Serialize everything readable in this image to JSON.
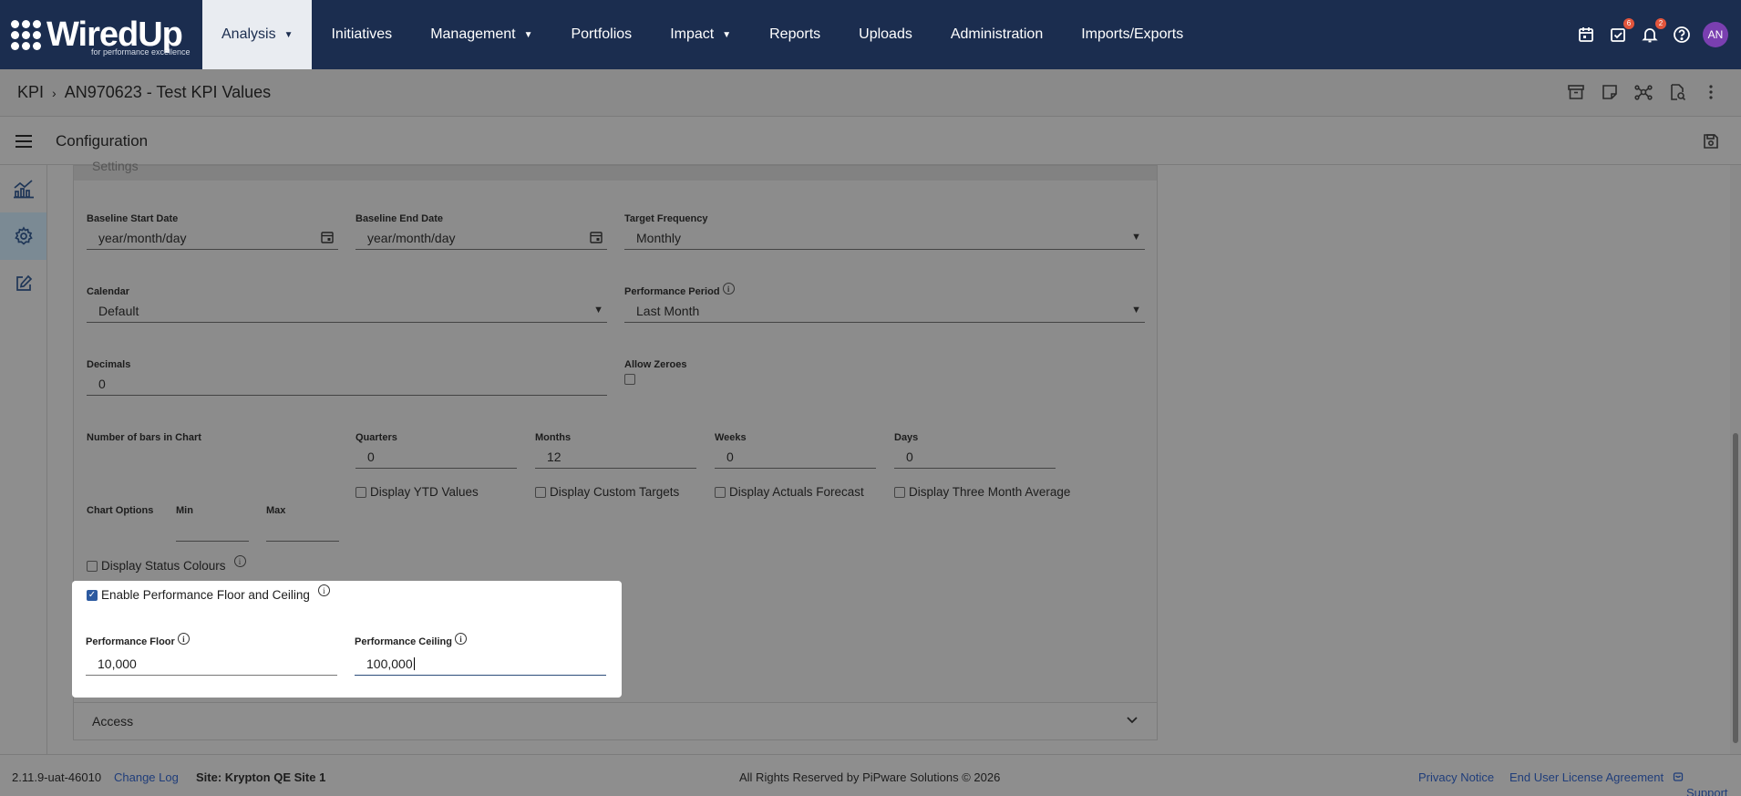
{
  "nav": {
    "logo_text": "WiredUp",
    "logo_sub": "for performance excellence",
    "items": [
      {
        "label": "Analysis",
        "caret": "▼"
      },
      {
        "label": "Initiatives",
        "caret": ""
      },
      {
        "label": "Management",
        "caret": "▼"
      },
      {
        "label": "Portfolios",
        "caret": ""
      },
      {
        "label": "Impact",
        "caret": "▼"
      },
      {
        "label": "Reports",
        "caret": ""
      },
      {
        "label": "Uploads",
        "caret": ""
      },
      {
        "label": "Administration",
        "caret": ""
      },
      {
        "label": "Imports/Exports",
        "caret": ""
      }
    ],
    "tasks_badge": "6",
    "notifications_badge": "2",
    "avatar": "AN"
  },
  "breadcrumb": {
    "root": "KPI",
    "sep": "›",
    "current": "AN970623 - Test KPI Values"
  },
  "config": {
    "title": "Configuration"
  },
  "settings": {
    "header": "Settings",
    "baseline_start": {
      "label": "Baseline Start Date",
      "value": "year/month/day"
    },
    "baseline_end": {
      "label": "Baseline End Date",
      "value": "year/month/day"
    },
    "target_frequency": {
      "label": "Target Frequency",
      "value": "Monthly"
    },
    "calendar": {
      "label": "Calendar",
      "value": "Default"
    },
    "performance_period": {
      "label": "Performance Period",
      "value": "Last Month"
    },
    "decimals": {
      "label": "Decimals",
      "value": "0"
    },
    "allow_zeroes": {
      "label": "Allow Zeroes"
    },
    "bars": {
      "label": "Number of bars in Chart"
    },
    "quarters": {
      "label": "Quarters",
      "value": "0"
    },
    "months": {
      "label": "Months",
      "value": "12"
    },
    "weeks": {
      "label": "Weeks",
      "value": "0"
    },
    "days": {
      "label": "Days",
      "value": "0"
    },
    "display_ytd": "Display YTD Values",
    "display_custom_targets": "Display Custom Targets",
    "display_actuals_forecast": "Display Actuals Forecast",
    "display_three_month_avg": "Display Three Month Average",
    "chart_options": "Chart Options",
    "min": "Min",
    "max": "Max",
    "display_status_colours": "Display Status Colours",
    "enable_floor_ceiling": "Enable Performance Floor and Ceiling",
    "performance_floor": {
      "label": "Performance Floor",
      "value": "10,000"
    },
    "performance_ceiling": {
      "label": "Performance Ceiling",
      "value": "100,000"
    }
  },
  "access": {
    "label": "Access"
  },
  "footer": {
    "version": "2.11.9-uat-46010",
    "change_log": "Change Log",
    "site": "Site: Krypton QE Site 1",
    "rights": "All Rights Reserved by PiPware Solutions © 2026",
    "privacy": "Privacy Notice",
    "eula": "End User License Agreement",
    "support": "Support"
  },
  "icon_glyphs": {
    "info": "i",
    "check": "✓"
  }
}
